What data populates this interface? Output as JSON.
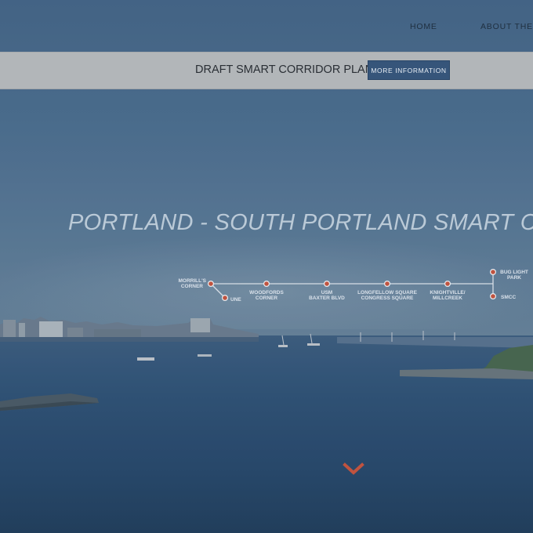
{
  "nav": {
    "home": "HOME",
    "about": "ABOUT THE S"
  },
  "banner": {
    "title": "DRAFT SMART CORRIDOR PLAN",
    "button": "MORE INFORMATION"
  },
  "hero": {
    "title": "PORTLAND - SOUTH PORTLAND SMART CORRI"
  },
  "route_map": {
    "stops": [
      {
        "line1": "MORRILL'S",
        "line2": "CORNER"
      },
      {
        "line1": "UNE",
        "line2": ""
      },
      {
        "line1": "WOODFORDS",
        "line2": "CORNER"
      },
      {
        "line1": "USM",
        "line2": "BAXTER BLVD"
      },
      {
        "line1": "LONGFELLOW SQUARE",
        "line2": "CONGRESS SQUARE"
      },
      {
        "line1": "KNIGHTVILLE/",
        "line2": "MILLCREEK"
      },
      {
        "line1": "BUG LIGHT",
        "line2": "PARK"
      },
      {
        "line1": "SMCC",
        "line2": ""
      }
    ]
  },
  "colors": {
    "accent": "#c0533f",
    "button": "#36557a",
    "banner": "#b2b6b9"
  },
  "icons": {
    "scroll": "chevron-down-icon"
  }
}
